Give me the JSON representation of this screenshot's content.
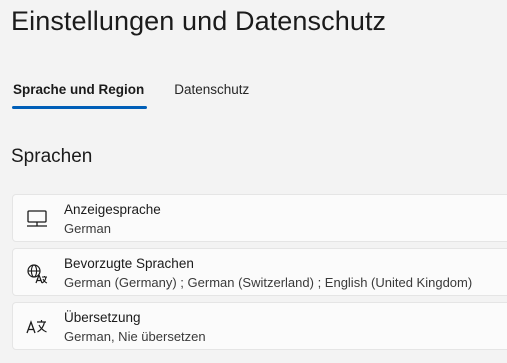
{
  "page": {
    "title": "Einstellungen und Datenschutz",
    "accent_color": "#005fb8"
  },
  "tabs": [
    {
      "label": "Sprache und Region",
      "active": true
    },
    {
      "label": "Datenschutz",
      "active": false
    }
  ],
  "section": {
    "heading": "Sprachen"
  },
  "settings": [
    {
      "icon": "monitor-icon",
      "label": "Anzeigesprache",
      "value": "German"
    },
    {
      "icon": "language-globe-icon",
      "label": "Bevorzugte Sprachen",
      "value": "German (Germany) ; German (Switzerland) ; English (United Kingdom)"
    },
    {
      "icon": "translate-icon",
      "label": "Übersetzung",
      "value": "German, Nie übersetzen"
    }
  ]
}
